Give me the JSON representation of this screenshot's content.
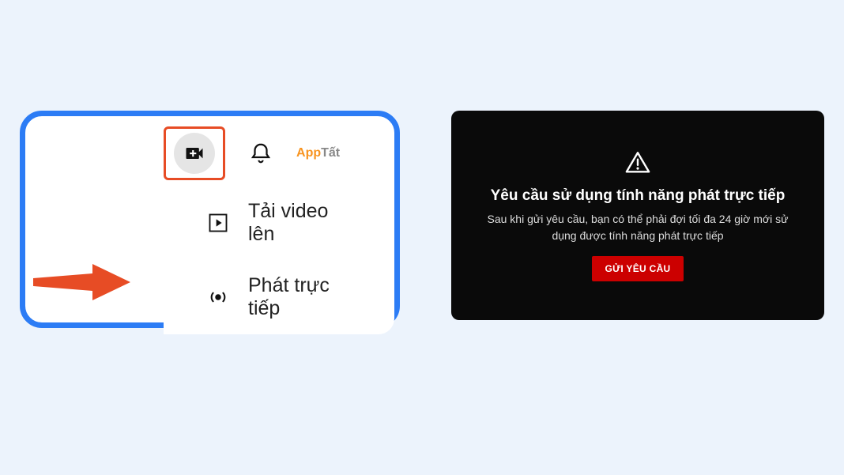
{
  "left": {
    "topbar": {
      "create_highlighted": true,
      "logo": {
        "prefix": "A",
        "mid": "pp",
        "suffix": "Tất"
      }
    },
    "menu": {
      "upload_label": "Tải video lên",
      "live_label": "Phát trực tiếp"
    }
  },
  "right": {
    "title": "Yêu cầu sử dụng tính năng phát trực tiếp",
    "description": "Sau khi gửi yêu cầu, bạn có thể phải đợi tối đa 24 giờ mới sử dụng được tính năng phát trực tiếp",
    "button_label": "GỬI YÊU CẦU"
  }
}
